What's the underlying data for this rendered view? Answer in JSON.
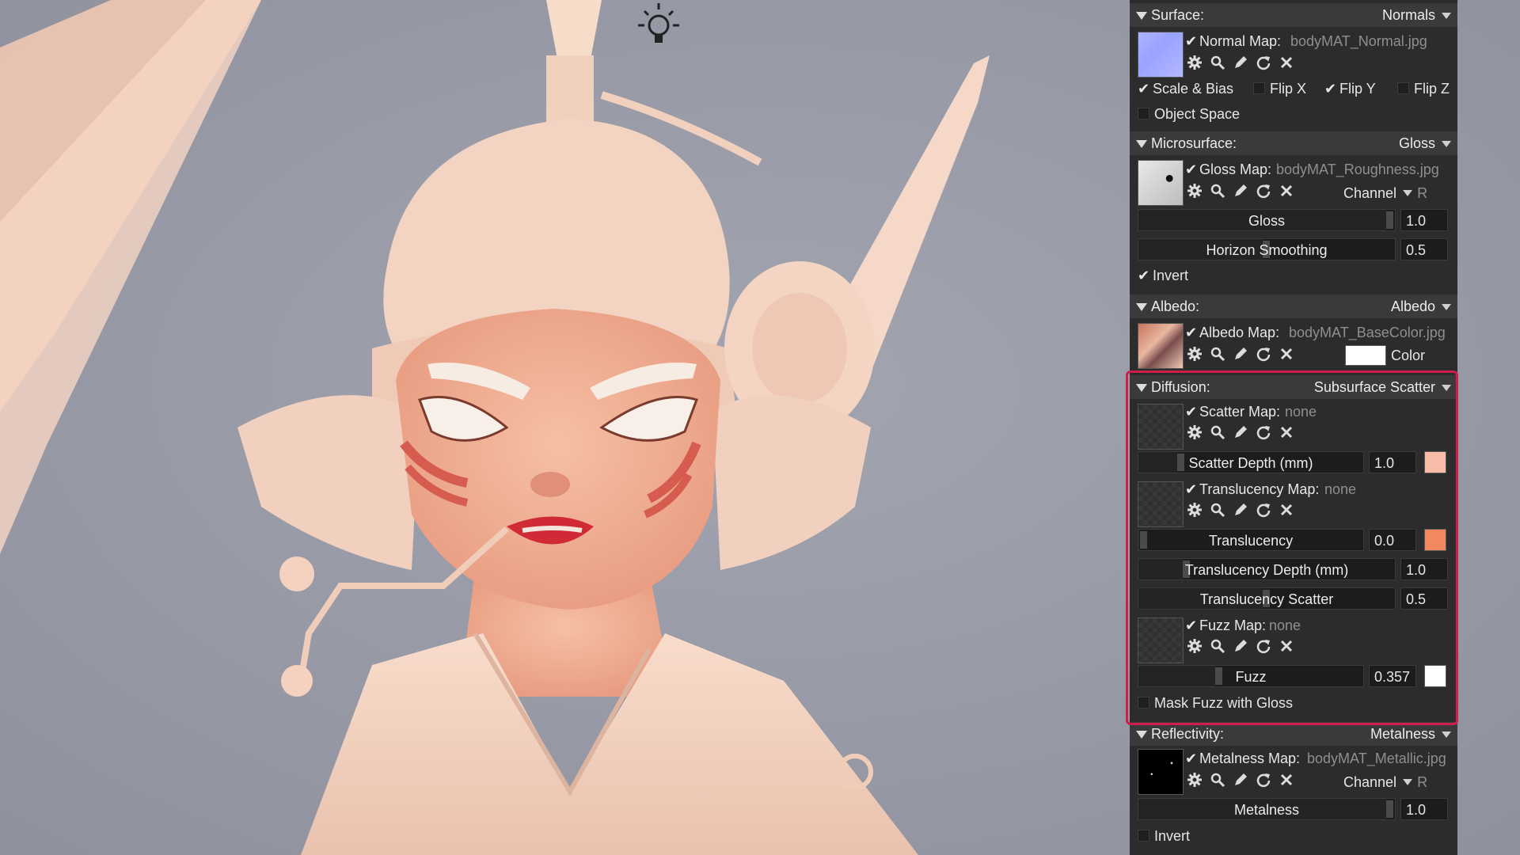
{
  "panel": {
    "surface": {
      "title": "Surface:",
      "mode": "Normals",
      "map_label": "Normal Map:",
      "map_file": "bodyMAT_Normal.jpg",
      "options": [
        {
          "label": "Scale & Bias",
          "checked": true
        },
        {
          "label": "Flip X",
          "checked": false
        },
        {
          "label": "Flip Y",
          "checked": true
        },
        {
          "label": "Flip Z",
          "checked": false
        },
        {
          "label": "Object Space",
          "checked": false
        }
      ]
    },
    "microsurface": {
      "title": "Microsurface:",
      "mode": "Gloss",
      "map_label": "Gloss Map:",
      "map_file": "bodyMAT_Roughness.jpg",
      "channel_label": "Channel",
      "channel_value": "R",
      "gloss": {
        "label": "Gloss",
        "value": "1.0",
        "level": 1.0
      },
      "horizon": {
        "label": "Horizon Smoothing",
        "value": "0.5",
        "level": 0.5
      },
      "invert": {
        "label": "Invert",
        "checked": true
      }
    },
    "albedo": {
      "title": "Albedo:",
      "mode": "Albedo",
      "map_label": "Albedo Map:",
      "map_file": "bodyMAT_BaseColor.jpg",
      "color_label": "Color",
      "color": "#ffffff"
    },
    "diffusion": {
      "title": "Diffusion:",
      "mode": "Subsurface Scatter",
      "scatter_map": {
        "label": "Scatter Map:",
        "file": "none"
      },
      "scatter_depth": {
        "label": "Scatter Depth (mm)",
        "value": "1.0",
        "level": 0.18,
        "color": "#f6bca8"
      },
      "translucency_map": {
        "label": "Translucency Map:",
        "file": "none"
      },
      "translucency": {
        "label": "Translucency",
        "value": "0.0",
        "level": 0.0,
        "color": "#f38860"
      },
      "translucency_depth": {
        "label": "Translucency Depth (mm)",
        "value": "1.0",
        "level": 0.18
      },
      "translucency_scatter": {
        "label": "Translucency Scatter",
        "value": "0.5",
        "level": 0.5
      },
      "fuzz_map": {
        "label": "Fuzz Map:",
        "file": "none"
      },
      "fuzz": {
        "label": "Fuzz",
        "value": "0.357",
        "level": 0.357,
        "color": "#ffffff"
      },
      "mask_fuzz": {
        "label": "Mask Fuzz with Gloss",
        "checked": false
      }
    },
    "reflectivity": {
      "title": "Reflectivity:",
      "mode": "Metalness",
      "map_label": "Metalness Map:",
      "map_file": "bodyMAT_Metallic.jpg",
      "channel_label": "Channel",
      "channel_value": "R",
      "metalness": {
        "label": "Metalness",
        "value": "1.0",
        "level": 1.0
      },
      "invert": {
        "label": "Invert",
        "checked": false
      }
    }
  },
  "colors": {
    "highlight": "#d01e4c",
    "panel_bg": "#2c2c2c",
    "viewport_bg": "#9799a6"
  }
}
